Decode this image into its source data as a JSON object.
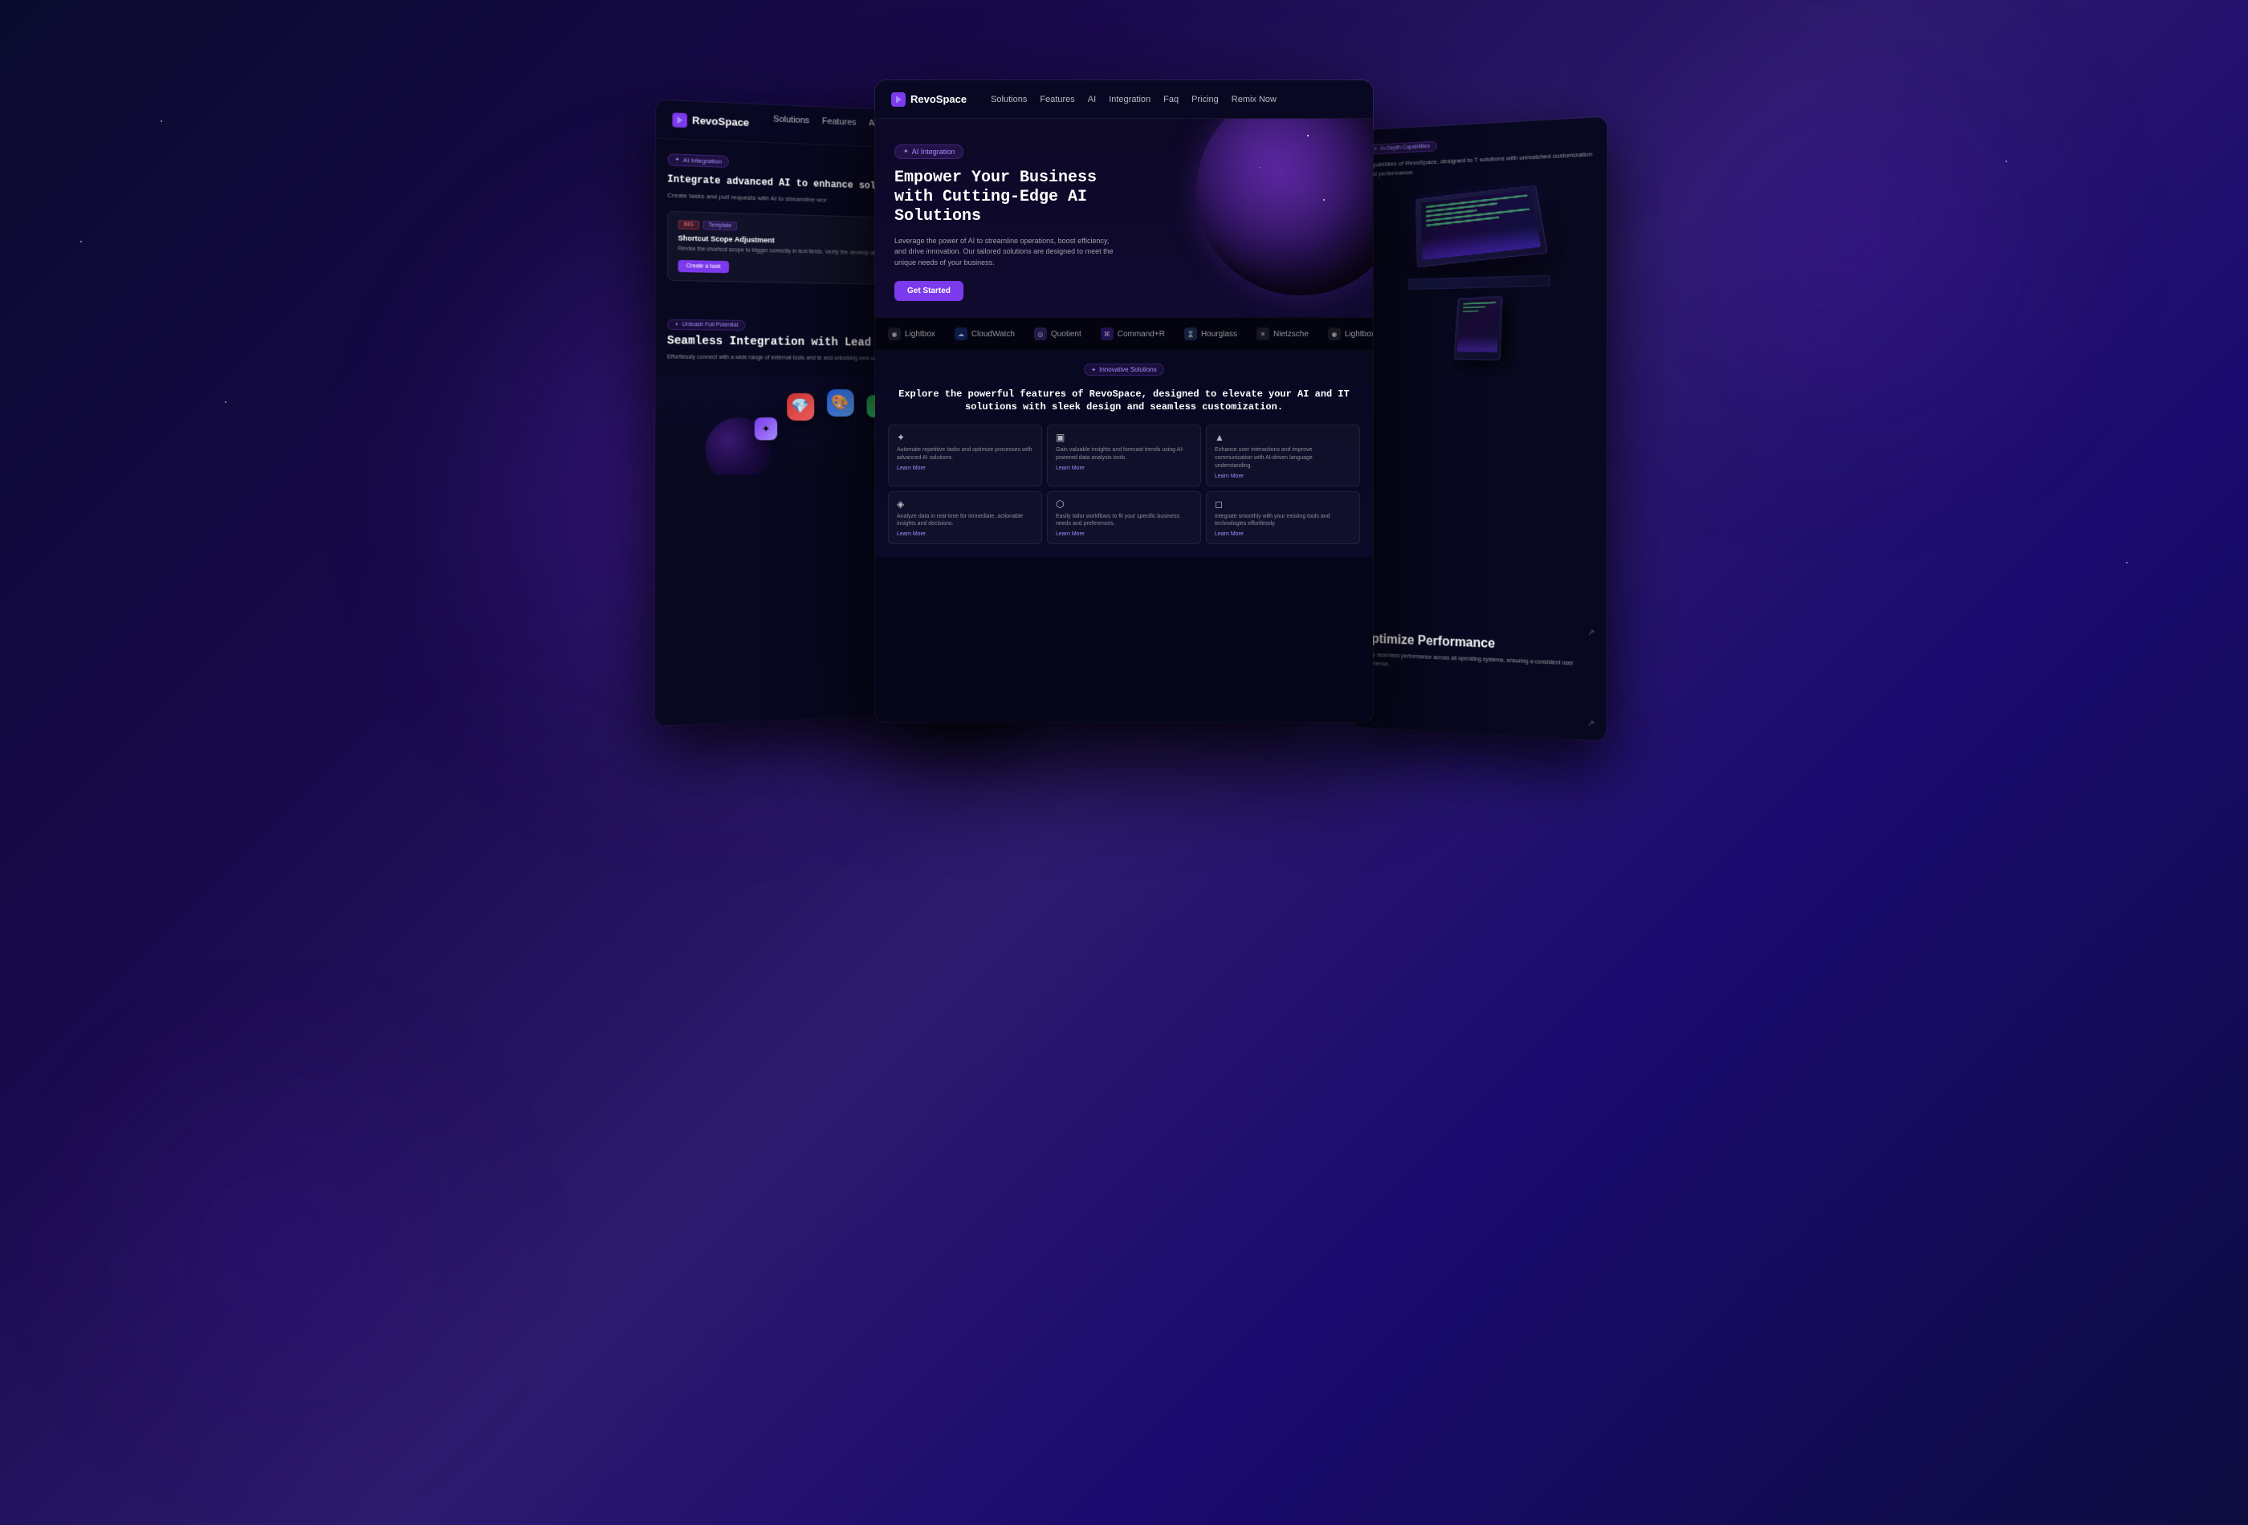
{
  "page": {
    "background": "dark-gradient",
    "title": "RevoSpace AI Solutions"
  },
  "navbar": {
    "logo": "RevoSpace",
    "logo_icon": "R",
    "links": [
      "Solutions",
      "Features",
      "AI",
      "Integration",
      "Faq",
      "Pricing",
      "Remix Now"
    ]
  },
  "hero": {
    "badge": "AI Integration",
    "title": "Empower Your Business with\nCutting-Edge AI Solutions",
    "subtitle": "Leverage the power of AI to streamline operations, boost efficiency, and drive innovation. Our tailored solutions are designed to meet the unique needs of your business.",
    "cta_button": "Get Started"
  },
  "left_panel": {
    "badge": "AI Integration",
    "title": "Integrate advanced AI to enhance solutions of",
    "subtitle": "Create tasks and pull requests with AI to streamline wor",
    "task_card": {
      "badge1": "BIG",
      "badge2": "Template",
      "title": "Shortcut Scope Adjustment",
      "description": "Revise the shortcut scope to trigger correctly in text fields. Verify the develop and test a solution, and document the changes.",
      "button": "Create a task"
    }
  },
  "logos": [
    {
      "name": "Lightbox",
      "icon": "◉"
    },
    {
      "name": "CloudWatch",
      "icon": "☁"
    },
    {
      "name": "Quotient",
      "icon": "◎"
    },
    {
      "name": "Command+R",
      "icon": "⌘"
    },
    {
      "name": "Hourglass",
      "icon": "⌛"
    },
    {
      "name": "Nietzsche",
      "icon": "✳"
    },
    {
      "name": "Lightbox",
      "icon": "◉"
    }
  ],
  "bottom_left": {
    "badge": "Unleash Full Potential",
    "title": "Seamless Integration with Lead",
    "description": "Effortlessly connect with a wide range of external tools and te and unlocking new capabilities"
  },
  "features": {
    "badge": "Innovative Solutions",
    "title": "Explore the powerful features of RevoSpace, designed\nto elevate your AI and IT solutions with sleek design\nand seamless customization.",
    "cards": [
      {
        "icon": "✦",
        "description": "Automate repetitive tasks and optimize processes with advanced AI solutions.",
        "link": "Learn More"
      },
      {
        "icon": "▣",
        "description": "Gain valuable insights and forecast trends using AI-powered data analysis tools.",
        "link": "Learn More"
      },
      {
        "icon": "▲",
        "description": "Enhance user interactions and improve communication with AI-driven language understanding.",
        "link": "Learn More"
      },
      {
        "icon": "◈",
        "description": "Analyze data in real-time for immediate, actionable insights and decisions.",
        "link": "Learn More"
      },
      {
        "icon": "⬡",
        "description": "Easily tailor workflows to fit your specific business needs and preferences.",
        "link": "Learn More"
      },
      {
        "icon": "◻",
        "description": "Integrate smoothly with your existing tools and technologies effortlessly.",
        "link": "Learn More"
      }
    ]
  },
  "right_panel": {
    "badge": "In-Depth Capabilities",
    "description": "capabilities of RevoSpace, designed to T solutions with unmatched customization and performance.",
    "bottom_title": "Optimize\nPerformance",
    "bottom_description": "Enjoy seamless performance across all operating systems, ensuring a consistent user experience."
  }
}
